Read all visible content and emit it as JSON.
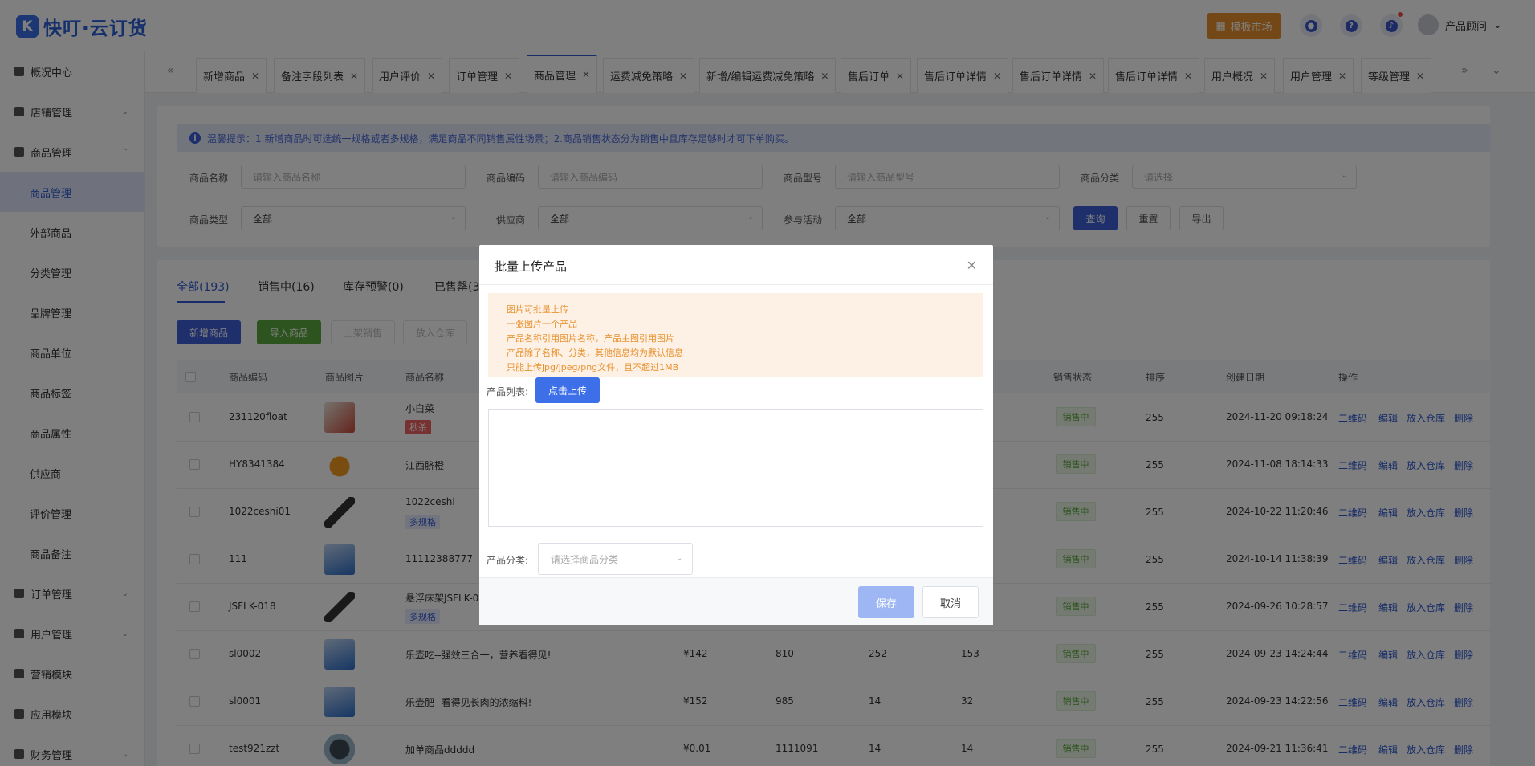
{
  "header": {
    "logo_mark": "K",
    "logo_text": "快叮·云订货",
    "template_market": "模板市场",
    "user_name": "产品顾问"
  },
  "sidebar": {
    "items": [
      {
        "label": "概况中心"
      },
      {
        "label": "店铺管理"
      },
      {
        "label": "商品管理"
      },
      {
        "label": "订单管理"
      },
      {
        "label": "用户管理"
      },
      {
        "label": "营销模块"
      },
      {
        "label": "应用模块"
      },
      {
        "label": "财务管理"
      }
    ],
    "sub_items": [
      "商品管理",
      "外部商品",
      "分类管理",
      "品牌管理",
      "商品单位",
      "商品标签",
      "商品属性",
      "供应商",
      "评价管理",
      "商品备注"
    ]
  },
  "tabs": [
    "新增商品",
    "备注字段列表",
    "用户评价",
    "订单管理",
    "商品管理",
    "运费减免策略",
    "新增/编辑运费减免策略",
    "售后订单",
    "售后订单详情",
    "售后订单详情",
    "售后订单详情",
    "用户概况",
    "用户管理",
    "等级管理"
  ],
  "filters": {
    "tip": "温馨提示：1.新增商品时可选统一规格或者多规格，满足商品不同销售属性场景；2.商品销售状态分为销售中且库存足够时才可下单购买。",
    "name_label": "商品名称",
    "name_ph": "请输入商品名称",
    "code_label": "商品编码",
    "code_ph": "请输入商品编码",
    "model_label": "商品型号",
    "model_ph": "请输入商品型号",
    "cat_label": "商品分类",
    "cat_ph": "请选择",
    "type_label": "商品类型",
    "type_val": "全部",
    "supplier_label": "供应商",
    "supplier_val": "全部",
    "activity_label": "参与活动",
    "activity_val": "全部",
    "query": "查询",
    "reset": "重置",
    "export": "导出"
  },
  "list": {
    "tabs": [
      "全部(193)",
      "销售中(16)",
      "库存预警(0)",
      "已售罄(3"
    ],
    "actions": [
      "新增商品",
      "导入商品",
      "上架销售",
      "放入仓库"
    ],
    "columns": {
      "code": "商品编码",
      "img": "商品图片",
      "name": "商品名称",
      "status": "销售状态",
      "sort": "排序",
      "date": "创建日期",
      "ops": "操作"
    },
    "ops": [
      "二维码",
      "编辑",
      "放入仓库",
      "删除"
    ],
    "rows": [
      {
        "code": "231120float",
        "name": "小白菜",
        "tag": "秒杀",
        "price": "",
        "c1": "",
        "c2": "",
        "c3": "",
        "status": "销售中",
        "sort": "255",
        "date": "2024-11-20 09:18:24"
      },
      {
        "code": "HY8341384",
        "name": "江西脐橙",
        "tag": "",
        "price": "",
        "c1": "",
        "c2": "",
        "c3": "",
        "status": "销售中",
        "sort": "255",
        "date": "2024-11-08 18:14:33"
      },
      {
        "code": "1022ceshi01",
        "name": "1022ceshi",
        "tag": "多规格",
        "price": "",
        "c1": "",
        "c2": "",
        "c3": "",
        "status": "销售中",
        "sort": "255",
        "date": "2024-10-22 11:20:46"
      },
      {
        "code": "111",
        "name": "11112388777",
        "tag": "",
        "price": "",
        "c1": "",
        "c2": "",
        "c3": "",
        "status": "销售中",
        "sort": "255",
        "date": "2024-10-14 11:38:39"
      },
      {
        "code": "JSFLK-018",
        "name": "悬浮床架JSFLK-0",
        "tag": "多规格",
        "price": "",
        "c1": "",
        "c2": "",
        "c3": "",
        "status": "销售中",
        "sort": "255",
        "date": "2024-09-26 10:28:57"
      },
      {
        "code": "sl0002",
        "name": "乐壶吃--强效三合一，营养看得见!",
        "tag": "",
        "price": "¥142",
        "c1": "810",
        "c2": "252",
        "c3": "153",
        "status": "销售中",
        "sort": "255",
        "date": "2024-09-23 14:24:44"
      },
      {
        "code": "sl0001",
        "name": "乐壶肥--看得见长肉的浓缩料!",
        "tag": "",
        "price": "¥152",
        "c1": "985",
        "c2": "14",
        "c3": "32",
        "status": "销售中",
        "sort": "255",
        "date": "2024-09-23 14:22:56"
      },
      {
        "code": "test921zzt",
        "name": "加单商品ddddd",
        "tag": "",
        "price": "¥0.01",
        "c1": "1111091",
        "c2": "14",
        "c3": "14",
        "status": "销售中",
        "sort": "255",
        "date": "2024-09-21 11:36:41"
      }
    ]
  },
  "modal": {
    "title": "批量上传产品",
    "notices": [
      "图片可批量上传",
      "一张图片一个产品",
      "产品名称引用图片名称，产品主图引用图片",
      "产品除了名称、分类，其他信息均为默认信息",
      "只能上传jpg/jpeg/png文件，且不超过1MB"
    ],
    "list_label": "产品列表:",
    "upload": "点击上传",
    "cat_label": "产品分类:",
    "cat_ph": "请选择商品分类",
    "save": "保存",
    "cancel": "取消"
  }
}
